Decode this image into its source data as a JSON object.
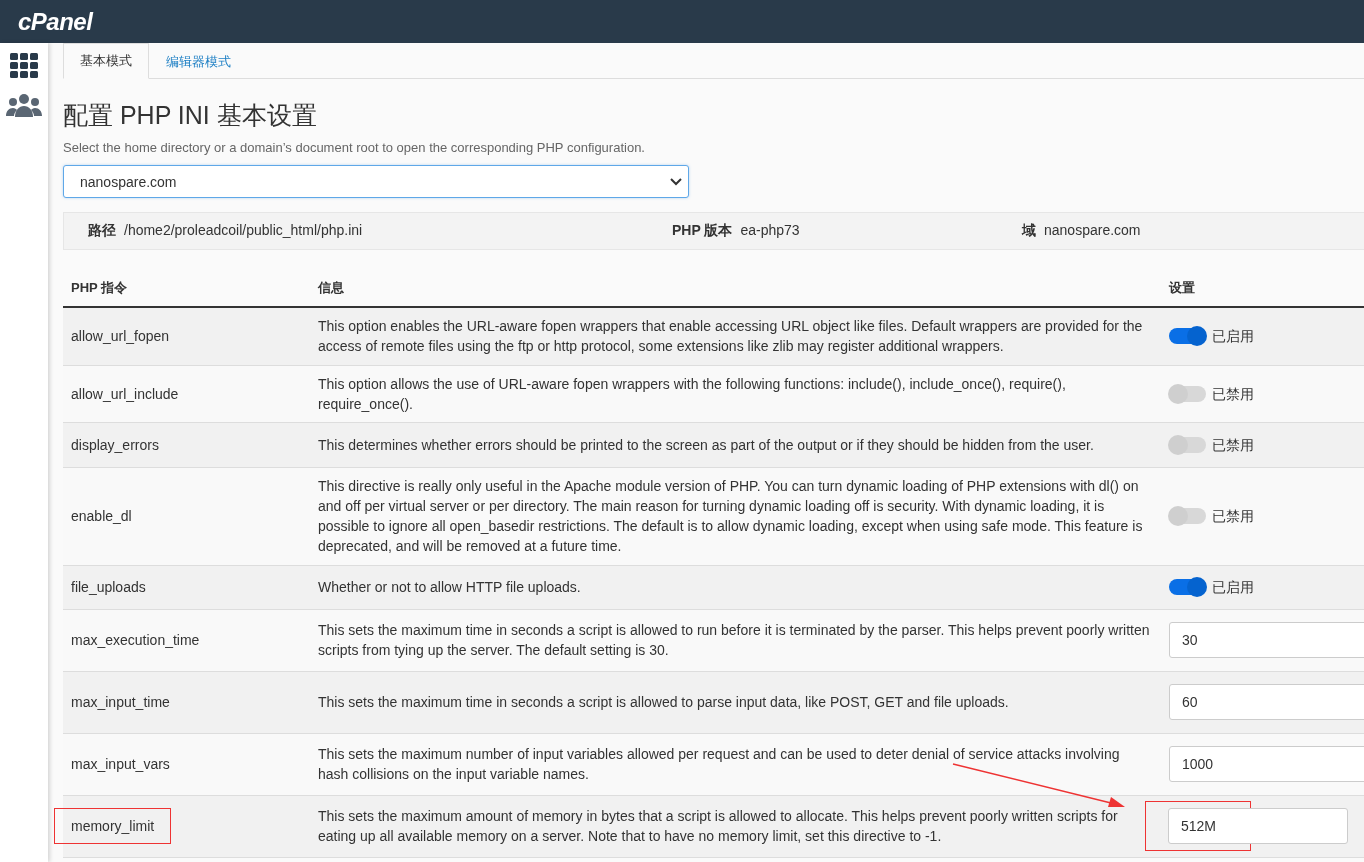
{
  "brand": "cPanel",
  "tabs": [
    {
      "label": "基本模式",
      "selected": true
    },
    {
      "label": "编辑器模式",
      "selected": false
    }
  ],
  "title": "配置 PHP INI 基本设置",
  "subtitle": "Select the home directory or a domain’s document root to open the corresponding PHP configuration.",
  "domain_select": {
    "value": "nanospare.com"
  },
  "info_bar": [
    {
      "label": "路径",
      "value": "/home2/proleadcoil/public_html/php.ini"
    },
    {
      "label": "PHP 版本",
      "value": "ea-php73"
    },
    {
      "label": "域",
      "value": "nanospare.com"
    }
  ],
  "table": {
    "columns": [
      "PHP 指令",
      "信息",
      "设置"
    ],
    "rows": [
      {
        "name": "allow_url_fopen",
        "info": "This option enables the URL-aware fopen wrappers that enable accessing URL object like files. Default wrappers are provided for the access of remote files using the ftp or http protocol, some extensions like zlib may register additional wrappers.",
        "kind": "toggle",
        "on": true,
        "state_label": "已启用",
        "highlighted": false
      },
      {
        "name": "allow_url_include",
        "info": "This option allows the use of URL-aware fopen wrappers with the following functions: include(), include_once(), require(), require_once().",
        "kind": "toggle",
        "on": false,
        "state_label": "已禁用",
        "highlighted": false
      },
      {
        "name": "display_errors",
        "info": "This determines whether errors should be printed to the screen as part of the output or if they should be hidden from the user.",
        "kind": "toggle",
        "on": false,
        "state_label": "已禁用",
        "highlighted": false
      },
      {
        "name": "enable_dl",
        "info": "This directive is really only useful in the Apache module version of PHP. You can turn dynamic loading of PHP extensions with dl() on and off per virtual server or per directory. The main reason for turning dynamic loading off is security. With dynamic loading, it is possible to ignore all open_basedir restrictions. The default is to allow dynamic loading, except when using safe mode. This feature is deprecated, and will be removed at a future time.",
        "kind": "toggle",
        "on": false,
        "state_label": "已禁用",
        "highlighted": false
      },
      {
        "name": "file_uploads",
        "info": "Whether or not to allow HTTP file uploads.",
        "kind": "toggle",
        "on": true,
        "state_label": "已启用",
        "highlighted": false
      },
      {
        "name": "max_execution_time",
        "info": "This sets the maximum time in seconds a script is allowed to run before it is terminated by the parser. This helps prevent poorly written scripts from tying up the server. The default setting is 30.",
        "kind": "text",
        "value": "30",
        "highlighted": false
      },
      {
        "name": "max_input_time",
        "info": "This sets the maximum time in seconds a script is allowed to parse input data, like POST, GET and file uploads.",
        "kind": "text",
        "value": "60",
        "highlighted": false
      },
      {
        "name": "max_input_vars",
        "info": "This sets the maximum number of input variables allowed per request and can be used to deter denial of service attacks involving hash collisions on the input variable names.",
        "kind": "text",
        "value": "1000",
        "highlighted": false
      },
      {
        "name": "memory_limit",
        "info": "This sets the maximum amount of memory in bytes that a script is allowed to allocate. This helps prevent poorly written scripts for eating up all available memory on a server. Note that to have no memory limit, set this directive to -1.",
        "kind": "text",
        "value": "512M",
        "highlighted": true
      }
    ]
  }
}
